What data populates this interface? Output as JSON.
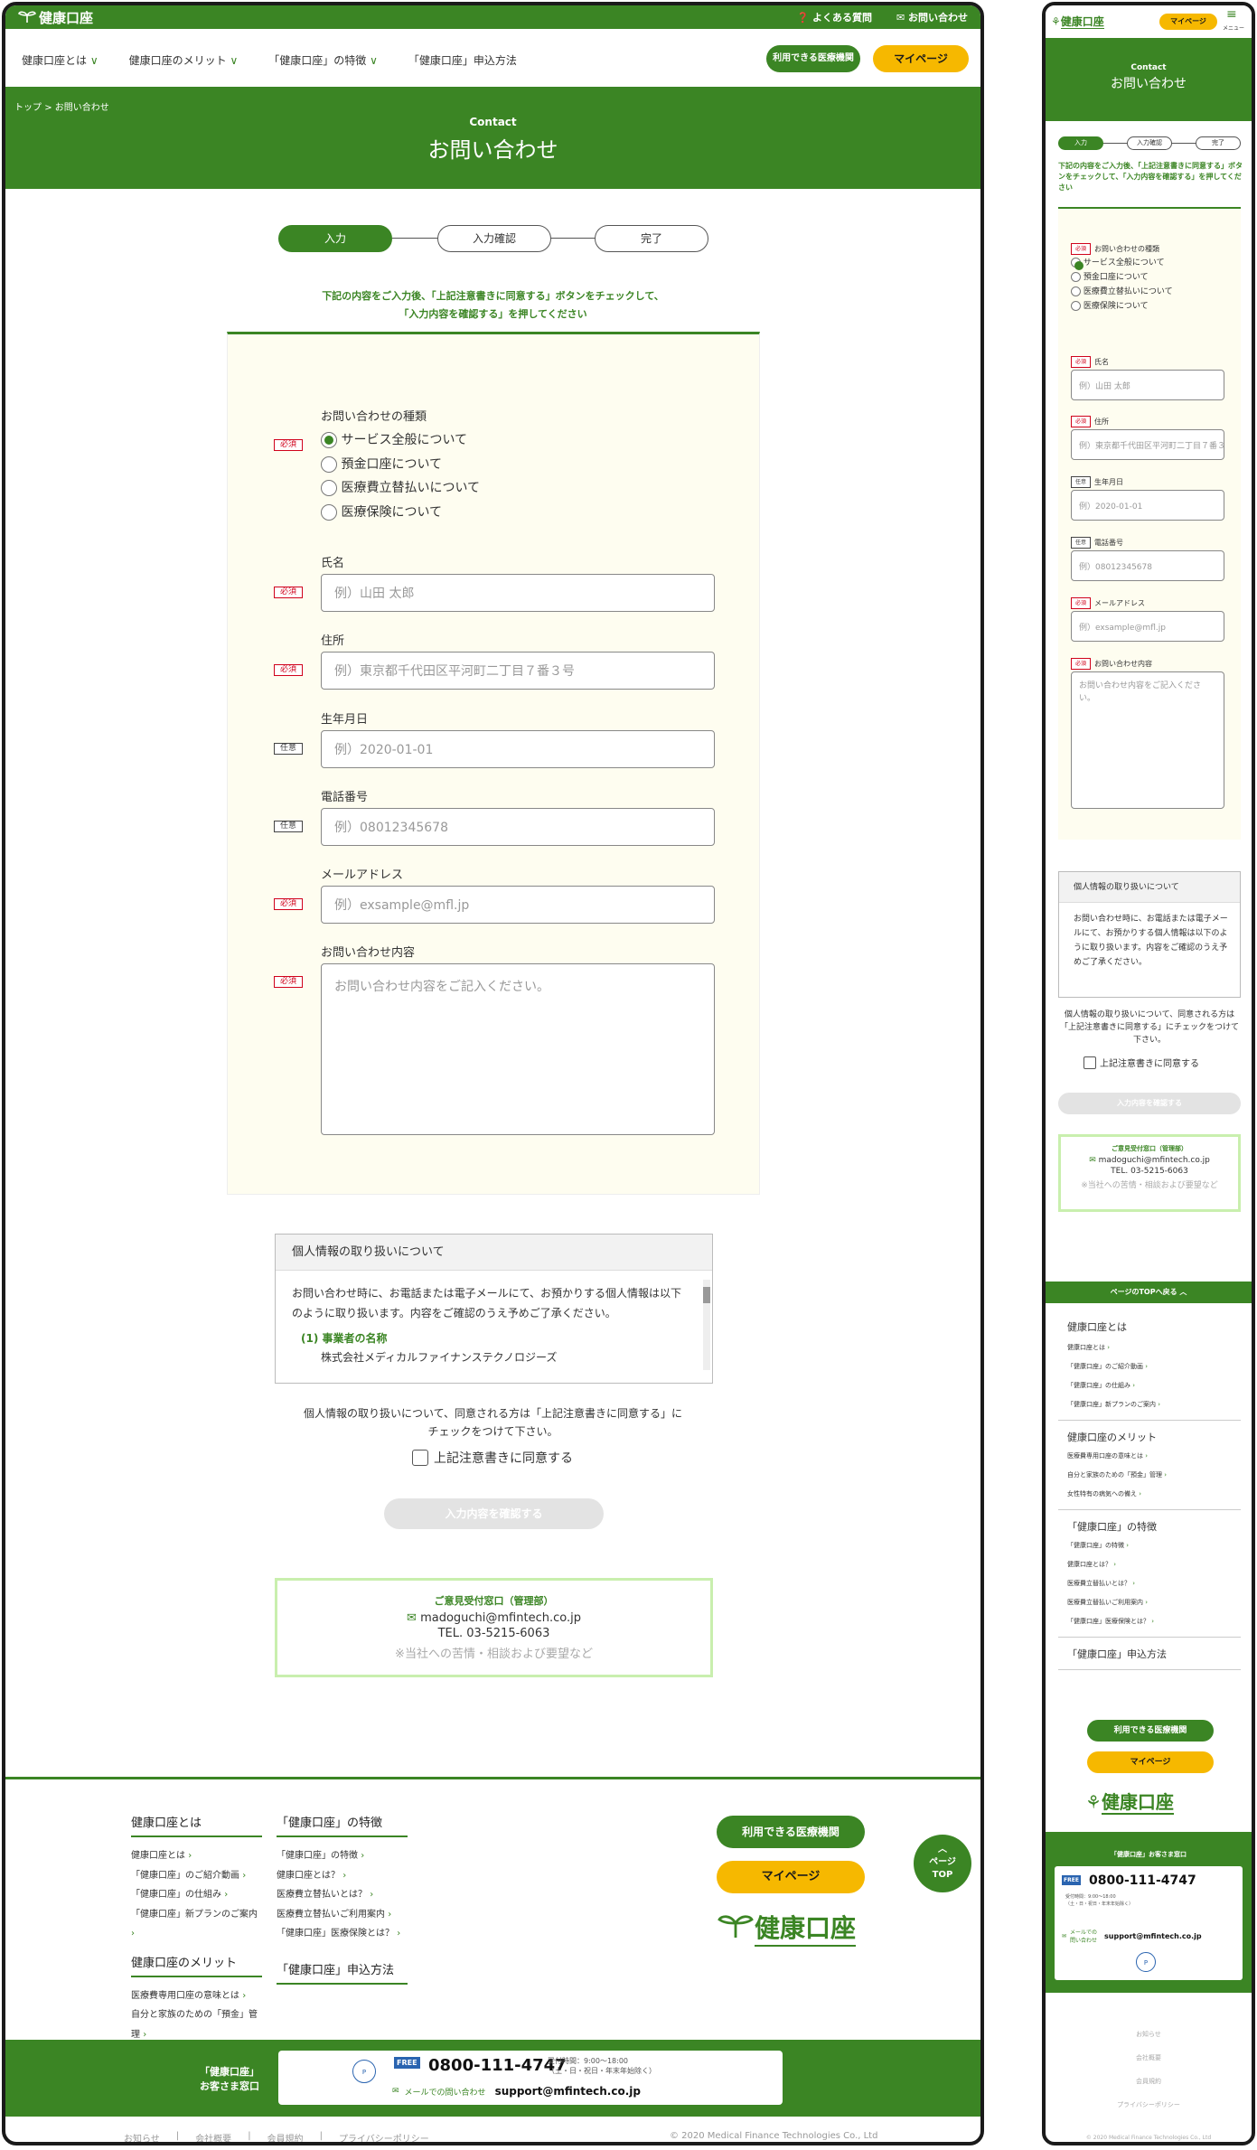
{
  "header": {
    "logo": "健康口座",
    "faq": "よくある質問",
    "contact": "お問い合わせ",
    "nav": [
      "健康口座とは",
      "健康口座のメリット",
      "「健康口座」の特徴",
      "「健康口座」申込方法"
    ],
    "btn_clinic": "利用できる医療機関",
    "btn_mypage": "マイページ",
    "menu": "メニュー"
  },
  "breadcrumb": {
    "top": "トップ",
    "sep": ">",
    "current": "お問い合わせ"
  },
  "hero": {
    "en": "Contact",
    "ja": "お問い合わせ"
  },
  "steps": [
    "入力",
    "入力確認",
    "完了"
  ],
  "intro": {
    "line1": "下記の内容をご入力後、「上記注意書きに同意する」ボタンをチェックして、",
    "line2": "「入力内容を確認する」を押してください"
  },
  "form": {
    "type": {
      "label": "お問い合わせの種類",
      "badge": "必須",
      "options": [
        "サービス全般について",
        "預金口座について",
        "医療費立替払いについて",
        "医療保険について"
      ]
    },
    "name": {
      "label": "氏名",
      "badge": "必須",
      "placeholder": "例）山田 太郎"
    },
    "address": {
      "label": "住所",
      "badge": "必須",
      "placeholder": "例）東京都千代田区平河町二丁目７番３号"
    },
    "birth": {
      "label": "生年月日",
      "badge": "任意",
      "placeholder": "例）2020-01-01"
    },
    "phone": {
      "label": "電話番号",
      "badge": "任意",
      "placeholder": "例）08012345678"
    },
    "email": {
      "label": "メールアドレス",
      "badge": "必須",
      "placeholder": "例）exsample@mfl.jp"
    },
    "message": {
      "label": "お問い合わせ内容",
      "badge": "必須",
      "placeholder": "お問い合わせ内容をご記入ください。"
    }
  },
  "privacy": {
    "title": "個人情報の取り扱いについて",
    "body": "お問い合わせ時に、お電話または電子メールにて、お預かりする個人情報は以下のように取り扱います。内容をご確認のうえ予めご了承ください。",
    "sub_title": "(1) 事業者の名称",
    "sub_body": "株式会社メディカルファイナンステクノロジーズ",
    "mob_body": "お問い合わせ時に、お電話または電子メールにて、お預かりする個人情報は以下のように取り扱います。内容をご確認のうえ予めご了承ください。",
    "consent_line1": "個人情報の取り扱いについて、同意される方は「上記注意書きに同意する」に",
    "consent_line2": "チェックをつけて下さい。",
    "mob_consent": "個人情報の取り扱いについて、同意される方は「上記注意書きに同意する」にチェックをつけて下さい。",
    "agree": "上記注意書きに同意する",
    "confirm": "入力内容を確認する"
  },
  "opinion": {
    "title": "ご意見受付窓口（管理部）",
    "email": "madoguchi@mfintech.co.jp",
    "tel": "TEL. 03-5215-6063",
    "note": "※当社への苦情・相談および要望など"
  },
  "footer": {
    "col1": {
      "title": "健康口座とは",
      "items": [
        "健康口座とは",
        "「健康口座」のご紹介動画",
        "「健康口座」の仕組み",
        "「健康口座」新プランのご案内"
      ]
    },
    "col2": {
      "title": "健康口座のメリット",
      "items": [
        "医療費専用口座の意味とは",
        "自分と家族のための「預金」管理",
        "女性特有の病気への備え"
      ]
    },
    "col3": {
      "title": "「健康口座」の特徴",
      "items": [
        "「健康口座」の特徴",
        "健康口座とは？",
        "医療費立替払いとは？",
        "医療費立替払いご利用案内",
        "「健康口座」医療保険とは？"
      ]
    },
    "col4": {
      "title": "「健康口座」申込方法"
    },
    "page_top": "ページ TOP",
    "mob_page_top": "ページのTOPへ戻る",
    "window_title": "「健康口座」お客さま窓口",
    "window_title_mob": "「健康口座」お客さま窓口",
    "free": "FREE",
    "tel": "0800-111-4747",
    "hours": "受付時間：9:00～18:00",
    "hours2": "（土・日・祝日・年末年始除く）",
    "mail_label": "メールでの問い合わせ",
    "mail": "support@mfintech.co.jp",
    "links": [
      "お知らせ",
      "会社概要",
      "会員規約",
      "プライバシーポリシー"
    ],
    "copy": "© 2020 Medical Finance Technologies Co., Ltd"
  },
  "colors": {
    "brand": "#3b8524",
    "accent": "#f6b800",
    "required": "#d0021b",
    "form_bg": "#fefdf0"
  }
}
